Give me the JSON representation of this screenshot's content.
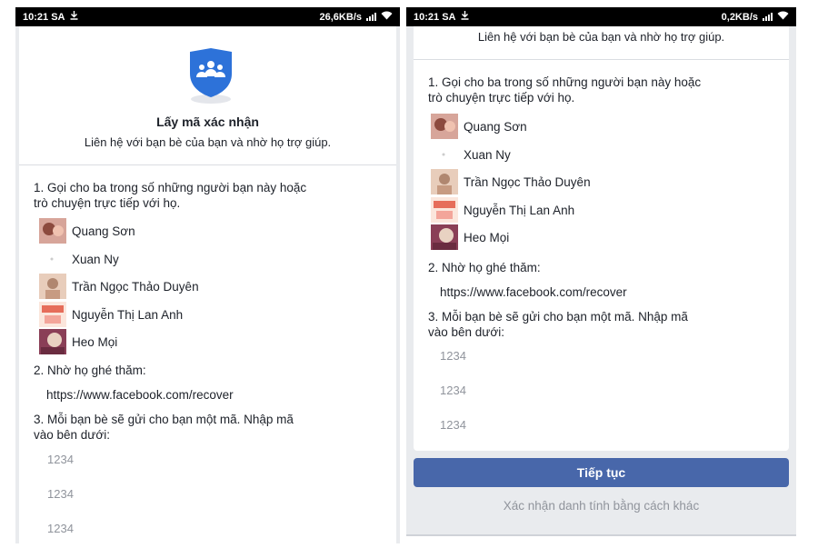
{
  "colors": {
    "primary_button": "#4867aa",
    "background": "#e9ebee",
    "status_bar": "#000000"
  },
  "left_screen": {
    "status": {
      "time": "10:21 SA",
      "download_icon": "download-arrow-icon",
      "speed": "26,6KB/s"
    },
    "title": "Lấy mã xác nhận",
    "subtitle": "Liên hệ với bạn bè của bạn và nhờ họ trợ giúp.",
    "step1_line1": "1. Gọi cho ba trong số những người bạn này hoặc",
    "step1_line2": "trò chuyện trực tiếp với họ.",
    "friends": [
      "Quang Sơn",
      "Xuan Ny",
      "Trần Ngọc Thảo Duyên",
      "Nguyễn Thị Lan Anh",
      "Heo Mọi"
    ],
    "step2": "2. Nhờ họ ghé thăm:",
    "url": "https://www.facebook.com/recover",
    "step3_line1": "3. Mỗi bạn bè sẽ gửi cho bạn một mã. Nhập mã",
    "step3_line2": "vào bên dưới:",
    "code_placeholders": [
      "1234",
      "1234",
      "1234"
    ]
  },
  "right_screen": {
    "status": {
      "time": "10:21 SA",
      "download_icon": "download-arrow-icon",
      "speed": "0,2KB/s"
    },
    "subtitle": "Liên hệ với bạn bè của bạn và nhờ họ trợ giúp.",
    "step1_line1": "1. Gọi cho ba trong số những người bạn này hoặc",
    "step1_line2": "trò chuyện trực tiếp với họ.",
    "friends": [
      "Quang Sơn",
      "Xuan Ny",
      "Trần Ngọc Thảo Duyên",
      "Nguyễn Thị Lan Anh",
      "Heo Mọi"
    ],
    "step2": "2. Nhờ họ ghé thăm:",
    "url": "https://www.facebook.com/recover",
    "step3_line1": "3. Mỗi bạn bè sẽ gửi cho bạn một mã. Nhập mã",
    "step3_line2": "vào bên dưới:",
    "code_placeholders": [
      "1234",
      "1234",
      "1234"
    ],
    "continue_button": "Tiếp tục",
    "alt_link": "Xác nhận danh tính bằng cách khác"
  }
}
